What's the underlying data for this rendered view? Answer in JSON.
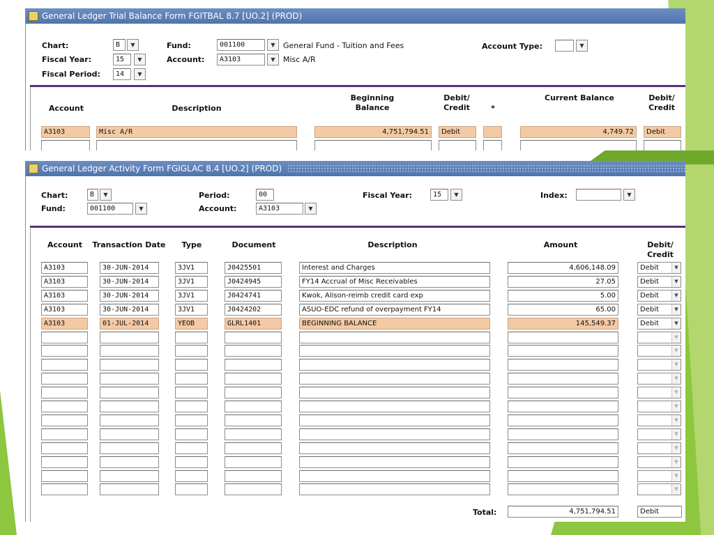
{
  "form1": {
    "title": "General Ledger Trial Balance Form  FGITBAL  8.7  [UO.2]  (PROD)",
    "labels": {
      "chart": "Chart:",
      "fiscal_year": "Fiscal Year:",
      "fiscal_period": "Fiscal Period:",
      "fund": "Fund:",
      "account": "Account:",
      "account_type": "Account Type:"
    },
    "values": {
      "chart": "B",
      "fiscal_year": "15",
      "fiscal_period": "14",
      "fund": "001100",
      "fund_desc": "General Fund - Tuition and Fees",
      "account": "A3103",
      "account_desc": "Misc A/R",
      "account_type": ""
    },
    "headers": {
      "account": "Account",
      "description": "Description",
      "beginning_balance": "Beginning Balance",
      "debit_credit_1": "Debit/ Credit",
      "star": "*",
      "current_balance": "Current Balance",
      "debit_credit_2": "Debit/ Credit"
    },
    "row": {
      "account": "A3103",
      "description": "Misc A/R",
      "beginning_balance": "4,751,794.51",
      "debit_credit_1": "Debit",
      "star": "",
      "current_balance": "4,749.72",
      "debit_credit_2": "Debit"
    }
  },
  "form2": {
    "title": "General Ledger Activity Form  FGIGLAC  8.4  [UO.2]  (PROD)",
    "labels": {
      "chart": "Chart:",
      "fund": "Fund:",
      "period": "Period:",
      "account": "Account:",
      "fiscal_year": "Fiscal Year:",
      "index": "Index:"
    },
    "values": {
      "chart": "B",
      "fund": "001100",
      "period": "00",
      "account": "A3103",
      "fiscal_year": "15",
      "index": ""
    },
    "headers": {
      "account": "Account",
      "transaction_date": "Transaction Date",
      "type": "Type",
      "document": "Document",
      "description": "Description",
      "amount": "Amount",
      "debit_credit": "Debit/ Credit"
    },
    "rows": [
      {
        "account": "A3103",
        "date": "30-JUN-2014",
        "type": "3JV1",
        "document": "J0425501",
        "description": "Interest and Charges",
        "amount": "4,606,148.09",
        "dc": "Debit"
      },
      {
        "account": "A3103",
        "date": "30-JUN-2014",
        "type": "3JV1",
        "document": "J0424945",
        "description": "FY14 Accrual of Misc Receivables",
        "amount": "27.05",
        "dc": "Debit"
      },
      {
        "account": "A3103",
        "date": "30-JUN-2014",
        "type": "3JV1",
        "document": "J0424741",
        "description": "Kwok, Alison-reimb credit card exp",
        "amount": "5.00",
        "dc": "Debit"
      },
      {
        "account": "A3103",
        "date": "30-JUN-2014",
        "type": "3JV1",
        "document": "J0424202",
        "description": "ASUO-EDC refund of overpayment FY14",
        "amount": "65.00",
        "dc": "Debit"
      },
      {
        "account": "A3103",
        "date": "01-JUL-2014",
        "type": "YEOB",
        "document": "GLRL1401",
        "description": "BEGINNING BALANCE",
        "amount": "145,549.37",
        "dc": "Debit"
      }
    ],
    "empty_rows": 12,
    "total_label": "Total:",
    "total_amount": "4,751,794.51",
    "total_dc": "Debit"
  },
  "icons": [
    "form-icon",
    "dropdown-arrow-icon"
  ],
  "colors": {
    "titlebar": "#4f74ad",
    "highlight": "#f3caa4",
    "divider": "#5b2e7a",
    "slide_green": "#8dc63f"
  }
}
